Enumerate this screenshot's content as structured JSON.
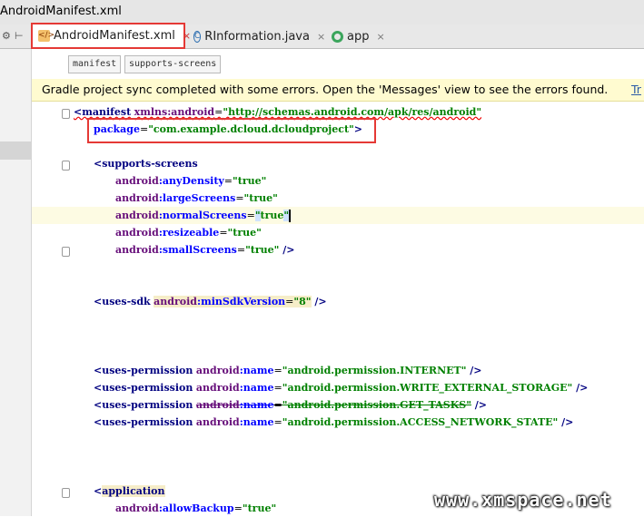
{
  "window": {
    "title": "AndroidManifest.xml"
  },
  "tabs": [
    {
      "label": "AndroidManifest.xml",
      "icon": "xml-file-icon",
      "active": true
    },
    {
      "label": "RInformation.java",
      "icon": "java-class-icon",
      "active": false
    },
    {
      "label": "app",
      "icon": "android-module-icon",
      "active": false
    }
  ],
  "tab_close_glyph": "×",
  "breadcrumbs": [
    "manifest",
    "supports-screens"
  ],
  "banner": {
    "message": "Gradle project sync completed with some errors. Open the 'Messages' view to see the errors found.",
    "link": "Tr"
  },
  "code": {
    "manifest_tag": "<manifest",
    "xmlns": "xmlns:android",
    "xmlns_value": "\"http://schemas.android.com/apk/res/android\"",
    "package_attr": "package",
    "package_value": "\"com.example.dcloud.dcloudproject\"",
    "supports_screens_tag": "<supports-screens",
    "ns": "android",
    "any_density": "anyDensity",
    "large_screens": "largeScreens",
    "normal_screens": "normalScreens",
    "resizeable": "resizeable",
    "small_screens": "smallScreens",
    "true_value": "\"true\"",
    "true_plain": "true",
    "quote": "\"",
    "uses_sdk_tag": "<uses-sdk",
    "min_sdk": "minSdkVersion",
    "min_sdk_value": "\"8\"",
    "uses_permission_tag": "<uses-permission",
    "name_attr": "name",
    "perm_internet": "\"android.permission.INTERNET\"",
    "perm_write": "\"android.permission.WRITE_EXTERNAL_STORAGE\"",
    "perm_get_tasks": "\"android.permission.GET_TASKS\"",
    "perm_network": "\"android.permission.ACCESS_NETWORK_STATE\"",
    "application_tag": "application",
    "lt": "<",
    "allow_backup": "allowBackup",
    "eq": "=",
    "colon": ":",
    "close_gt": ">",
    "close_self": " />"
  },
  "watermark": "www.xmspace.net",
  "colors": {
    "highlight_box": "#e53935",
    "banner_bg": "#fffbd0",
    "tag": "#000080",
    "namespace": "#660e7a",
    "attribute": "#0000ff",
    "value": "#008000"
  }
}
